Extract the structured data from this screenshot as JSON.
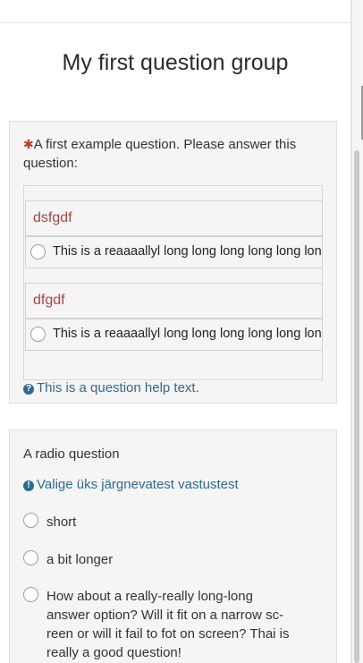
{
  "group": {
    "title": "My first question group"
  },
  "question1": {
    "mandatory_mark": "✱",
    "text": "A first example question. Please answer this question:",
    "subquestions": [
      {
        "label": "dsfgdf",
        "option": "This is a reaaaallyl long long long long long long"
      },
      {
        "label": "dfgdf",
        "option": "This is a reaaaallyl long long long long long long"
      }
    ],
    "help_text": "This is a question help text."
  },
  "question2": {
    "text": "A radio question",
    "tip": "Valige üks järgnevatest vastustest",
    "answers": [
      "short",
      "a bit longer",
      "How about a really-really long-long answer option? Will it fit on a narrow sc-reen or will it fail to fot on screen? Thai is really a good question!"
    ]
  },
  "icons": {
    "info": "info-circle-icon",
    "tip": "exclamation-circle-icon"
  },
  "colors": {
    "mandatory": "#c0392b",
    "subquestion_label": "#a94442",
    "help": "#2f6a8f"
  }
}
